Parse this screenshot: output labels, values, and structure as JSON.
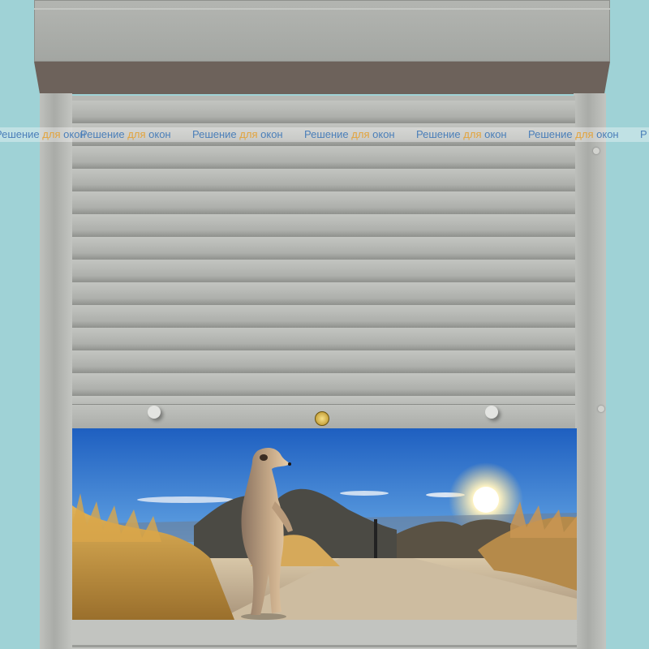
{
  "watermark": {
    "items": [
      {
        "w1": "Решение",
        "w2": "для",
        "w3": "окон"
      },
      {
        "w1": "Решение",
        "w2": "для",
        "w3": "окон"
      },
      {
        "w1": "Решение",
        "w2": "для",
        "w3": "окон"
      },
      {
        "w1": "Решение",
        "w2": "для",
        "w3": "окон"
      },
      {
        "w1": "Решение",
        "w2": "для",
        "w3": "окон"
      },
      {
        "w1": "Решение",
        "w2": "для",
        "w3": "окон"
      },
      {
        "w1": "Р",
        "w2": "",
        "w3": ""
      }
    ]
  },
  "colors": {
    "background": "#9fd2d6",
    "shutter": "#b6b8b4",
    "cassette_bottom": "#6d625b",
    "watermark_text": "#4b7fb9",
    "watermark_accent": "#e3a33b"
  },
  "photo": {
    "subject": "meerkat-at-sunset"
  }
}
